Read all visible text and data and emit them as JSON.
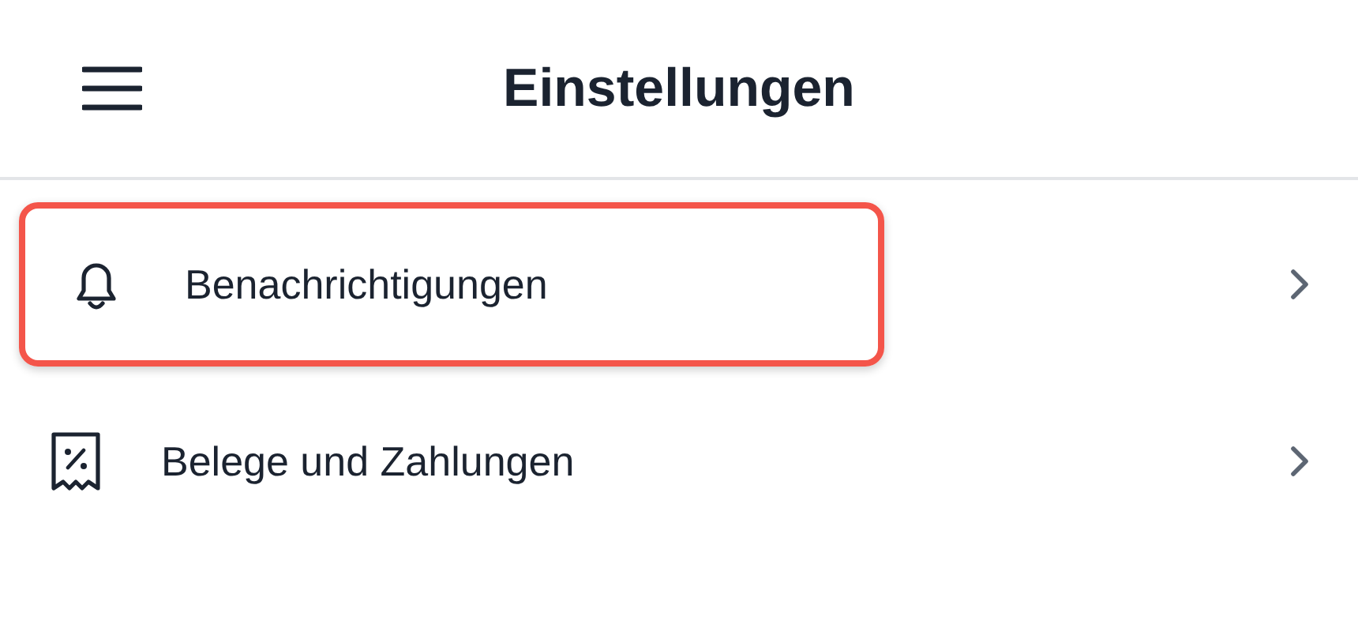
{
  "header": {
    "title": "Einstellungen"
  },
  "items": [
    {
      "kind": "bell",
      "label": "Benachrichtigungen",
      "highlighted": true
    },
    {
      "kind": "receipt",
      "label": "Belege und Zahlungen",
      "highlighted": false
    }
  ]
}
